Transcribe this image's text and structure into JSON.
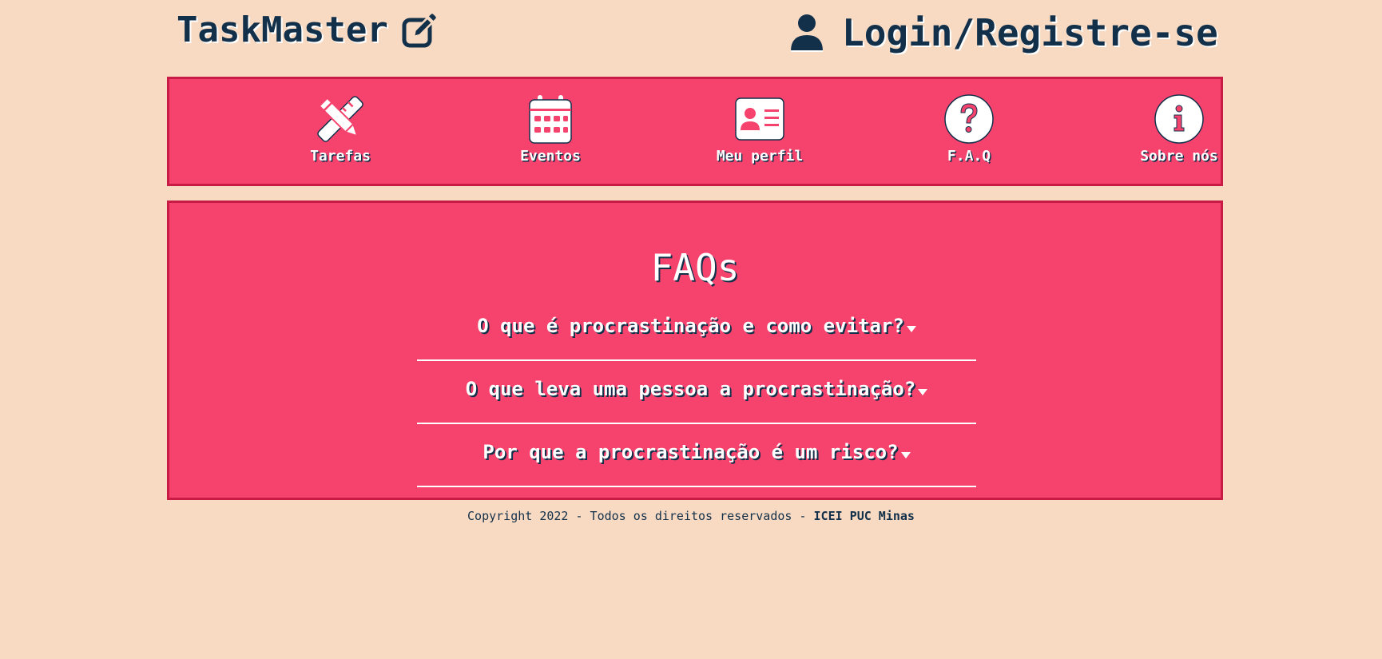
{
  "header": {
    "brand": "TaskMaster",
    "brand_icon": "edit-icon",
    "login_label": "Login/Registre-se",
    "login_icon": "user-icon"
  },
  "nav": {
    "items": [
      {
        "label": "Tarefas",
        "icon": "pencil-ruler-icon"
      },
      {
        "label": "Eventos",
        "icon": "calendar-icon"
      },
      {
        "label": "Meu perfil",
        "icon": "id-card-icon"
      },
      {
        "label": "F.A.Q",
        "icon": "question-circle-icon"
      },
      {
        "label": "Sobre nós",
        "icon": "info-circle-icon"
      }
    ]
  },
  "faq": {
    "title": "FAQs",
    "questions": [
      "O que é procrastinação e como evitar?",
      "O que leva uma pessoa a procrastinação?",
      "Por que a procrastinação é um risco?"
    ]
  },
  "footer": {
    "text": "Copyright 2022 - Todos os direitos reservados - ",
    "org": "ICEI PUC Minas"
  },
  "colors": {
    "background": "#f8dac2",
    "accent": "#f5436e",
    "border": "#c81b45",
    "text_dark": "#13304a"
  }
}
